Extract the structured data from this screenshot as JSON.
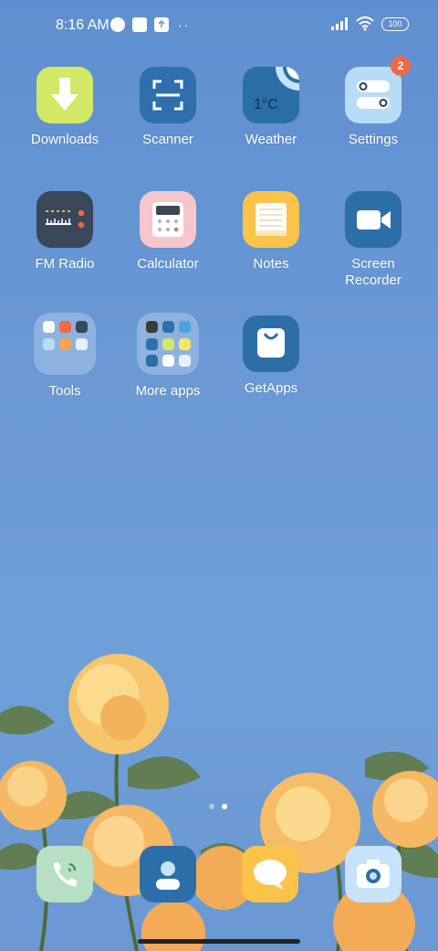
{
  "status": {
    "time": "8:16 AM",
    "battery": "100"
  },
  "apps": [
    {
      "label": "Downloads"
    },
    {
      "label": "Scanner"
    },
    {
      "label": "Weather",
      "temp": "1°C"
    },
    {
      "label": "Settings",
      "badge": "2"
    },
    {
      "label": "FM Radio"
    },
    {
      "label": "Calculator"
    },
    {
      "label": "Notes"
    },
    {
      "label": "Screen\nRecorder"
    },
    {
      "label": "Tools"
    },
    {
      "label": "More apps"
    },
    {
      "label": "GetApps"
    }
  ],
  "dock": [
    "phone-icon",
    "contacts-icon",
    "messages-icon",
    "camera-icon"
  ],
  "pager": {
    "pages": 2,
    "current": 2
  },
  "colors": {
    "badge": "#ee6a43",
    "downloads": "#d3e864",
    "scanner": "#2f6fae",
    "notes": "#fbc34a"
  }
}
